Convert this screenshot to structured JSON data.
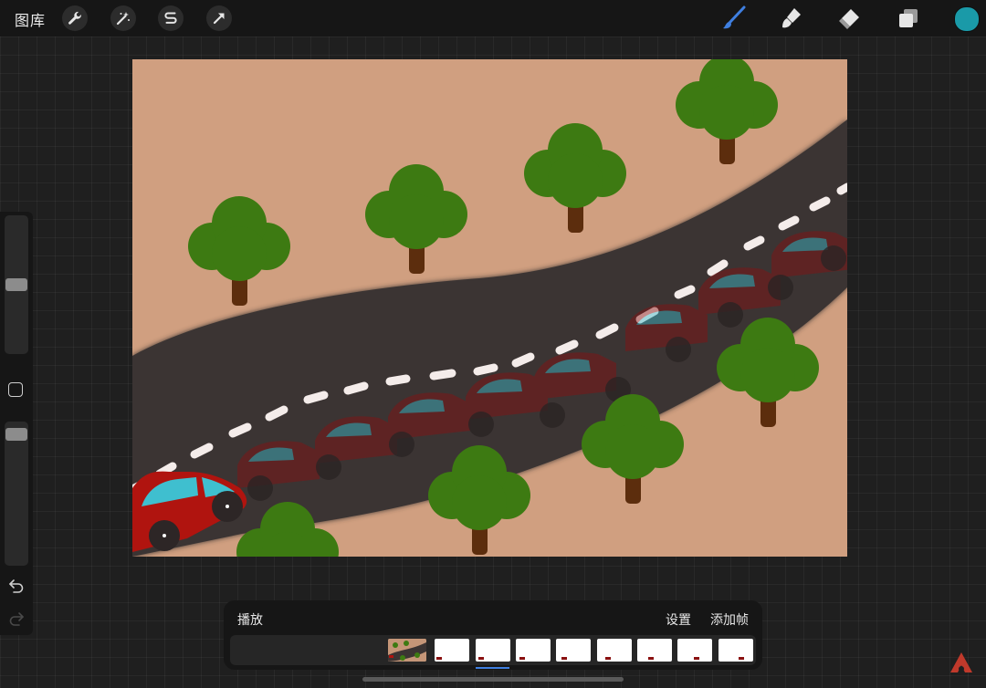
{
  "topbar": {
    "gallery_label": "图库",
    "left_tools": [
      "wrench-icon",
      "magic-wand-icon",
      "selection-s-icon",
      "transform-arrow-icon"
    ],
    "right_tools": [
      "brush-icon",
      "smudge-icon",
      "eraser-icon",
      "layers-icon"
    ],
    "current_color": "#1a9aa8",
    "active_tool_color": "#3f7fe0"
  },
  "sidebar": {
    "brush_size_level": 0.5,
    "opacity_level": 0.95
  },
  "animation": {
    "play_label": "播放",
    "settings_label": "设置",
    "add_frame_label": "添加帧",
    "frame_count": 9,
    "selected_frame": 2
  },
  "colors": {
    "canvas_ground": "#d09f80",
    "road": "#3b3433",
    "tree_green": "#3d7a12",
    "trunk": "#5c2d0d",
    "car_red": "#b0140f",
    "car_window": "#3fbfcf"
  }
}
